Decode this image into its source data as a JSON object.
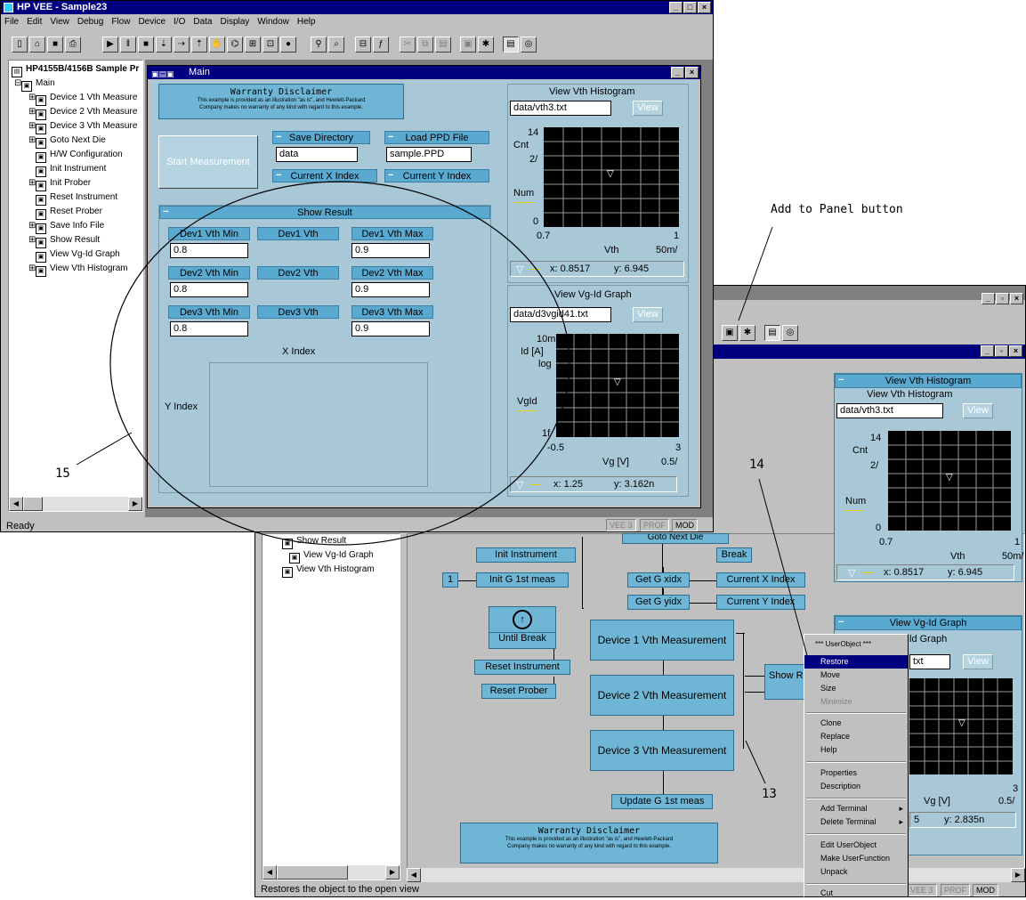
{
  "front": {
    "app_title": "HP VEE - Sample23",
    "menu": [
      "File",
      "Edit",
      "View",
      "Debug",
      "Flow",
      "Device",
      "I/O",
      "Data",
      "Display",
      "Window",
      "Help"
    ],
    "tree_root": "HP4155B/4156B Sample Pr",
    "tree_items": [
      "Main",
      "Device 1 Vth Measure",
      "Device 2 Vth Measure",
      "Device 3 Vth Measure",
      "Goto Next Die",
      "H/W Configuration",
      "Init Instrument",
      "Init Prober",
      "Reset Instrument",
      "Reset Prober",
      "Save Info File",
      "Show Result",
      "View Vg-Id Graph",
      "View Vth Histogram"
    ],
    "main_title": "Main",
    "status_text": "Ready",
    "status_pills": [
      "VEE 3",
      "PROF",
      "MOD"
    ]
  },
  "panel": {
    "disclaimer_title": "Warranty Disclaimer",
    "disclaimer_line1": "This example is provided as an illustration \"as is\", and Hewlett-Packard",
    "disclaimer_line2": "Company makes no warranty of any kind with regard to this example.",
    "start_button": "Start Measurement",
    "save_dir_label": "Save Directory",
    "save_dir_value": "data",
    "load_ppd_label": "Load PPD File",
    "load_ppd_value": "sample.PPD",
    "cur_x_label": "Current X Index",
    "cur_y_label": "Current Y Index",
    "show_result": "Show Result",
    "dev1_min": "Dev1 Vth Min",
    "dev1_vth": "Dev1 Vth",
    "dev1_max": "Dev1 Vth Max",
    "dev2_min": "Dev2 Vth Min",
    "dev2_vth": "Dev2 Vth",
    "dev2_max": "Dev2 Vth Max",
    "dev3_min": "Dev3 Vth Min",
    "dev3_vth": "Dev3 Vth",
    "dev3_max": "Dev3 Vth Max",
    "dev1_min_val": "0.8",
    "dev1_max_val": "0.9",
    "dev2_min_val": "0.8",
    "dev2_max_val": "0.9",
    "dev3_min_val": "0.8",
    "dev3_max_val": "0.9",
    "x_index": "X Index",
    "y_index": "Y Index"
  },
  "hist": {
    "title": "View Vth Histogram",
    "file": "data/vth3.txt",
    "view_btn": "View",
    "y_top": "14",
    "y_label": "Cnt",
    "y_div": "2/",
    "num": "Num",
    "y_zero": "0",
    "x_left": "0.7",
    "x_label": "Vth",
    "x_right": "1",
    "x_div": "50m/",
    "readout_x": "x: 0.8517",
    "readout_y": "y: 6.945"
  },
  "vgid": {
    "title": "View Vg-Id Graph",
    "file": "data/d3vgid41.txt",
    "view_btn": "View",
    "y_top": "10m",
    "y_label": "Id [A]",
    "y_scale": "log",
    "trace": "VgId",
    "y_bot": "1f",
    "x_left": "-0.5",
    "x_label": "Vg [V]",
    "x_right": "3",
    "x_div": "0.5/",
    "readout_x": "x: 1.25",
    "readout_y": "y: 3.162n"
  },
  "annot": {
    "add_to_panel": "Add to Panel button",
    "n13": "13",
    "n14": "14",
    "n15": "15"
  },
  "back": {
    "tree_items": [
      "Show Result",
      "View Vg-Id Graph",
      "View Vth Histogram"
    ],
    "boxes": {
      "goto_next_die": "Goto Next Die",
      "break": "Break",
      "init_instrument": "Init Instrument",
      "one": "1",
      "init_g": "Init G  1st  meas",
      "get_xidx": "Get G  xidx",
      "get_yidx": "Get G  yidx",
      "current_x": "Current X Index",
      "current_y": "Current Y Index",
      "until_break": "Until Break",
      "reset_instrument": "Reset Instrument",
      "reset_prober": "Reset Prober",
      "dev1": "Device 1 Vth Measurement",
      "dev2": "Device 2 Vth Measurement",
      "dev3": "Device 3 Vth Measurement",
      "show_r": "Show R",
      "update_g": "Update G  1st  meas"
    },
    "hist_title": "View Vth Histogram",
    "hist_file": "data/vth3.txt",
    "hist_view": "View",
    "hist_y_top": "14",
    "hist_y_label": "Cnt",
    "hist_y_div": "2/",
    "hist_num": "Num",
    "hist_y_zero": "0",
    "hist_x_left": "0.7",
    "hist_x_label": "Vth",
    "hist_x_right": "1",
    "hist_x_div": "50m/",
    "hist_readout_x": "x: 0.8517",
    "hist_readout_y": "y: 6.945",
    "vgid_title": "View Vg-Id Graph",
    "vgid_title_partial": "ld Graph",
    "vgid_file_partial": "txt",
    "vgid_view": "View",
    "vgid_x_right": "3",
    "vgid_x_label": "Vg [V]",
    "vgid_x_div": "0.5/",
    "vgid_readout_x": "5",
    "vgid_readout_y": "y: 2.835n",
    "status_text": "Restores the object to the open view",
    "status_pills": [
      "VEE 3",
      "PROF",
      "MOD"
    ]
  },
  "context_menu": {
    "header": "*** UserObject ***",
    "items": [
      "Restore",
      "Move",
      "Size",
      "Minimize",
      "Clone",
      "Replace",
      "Help",
      "Properties",
      "Description",
      "Add Terminal",
      "Delete Terminal",
      "Edit UserObject",
      "Make UserFunction",
      "Unpack",
      "Cut"
    ]
  }
}
